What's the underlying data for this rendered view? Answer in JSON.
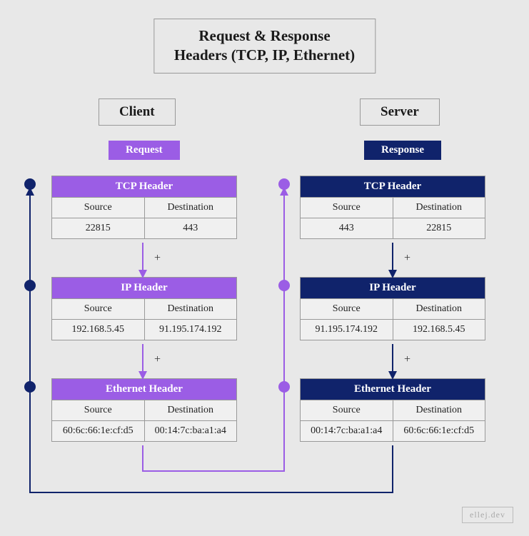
{
  "title_line1": "Request & Response",
  "title_line2": "Headers (TCP, IP, Ethernet)",
  "roles": {
    "client": "Client",
    "server": "Server"
  },
  "phases": {
    "request": "Request",
    "response": "Response"
  },
  "labels": {
    "tcp": "TCP Header",
    "ip": "IP Header",
    "ethernet": "Ethernet Header",
    "source": "Source",
    "destination": "Destination",
    "plus": "+"
  },
  "client": {
    "tcp": {
      "source": "22815",
      "destination": "443"
    },
    "ip": {
      "source": "192.168.5.45",
      "destination": "91.195.174.192"
    },
    "ethernet": {
      "source": "60:6c:66:1e:cf:d5",
      "destination": "00:14:7c:ba:a1:a4"
    }
  },
  "server": {
    "tcp": {
      "source": "443",
      "destination": "22815"
    },
    "ip": {
      "source": "91.195.174.192",
      "destination": "192.168.5.45"
    },
    "ethernet": {
      "source": "00:14:7c:ba:a1:a4",
      "destination": "60:6c:66:1e:cf:d5"
    }
  },
  "attribution": "ellej.dev",
  "colors": {
    "purple": "#9b5de5",
    "navy": "#10236b"
  }
}
